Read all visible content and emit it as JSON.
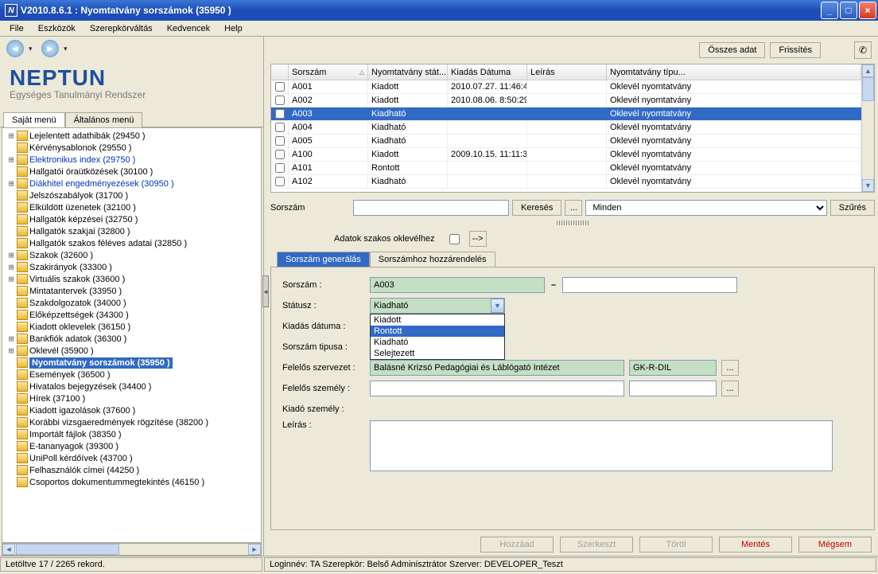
{
  "titlebar": {
    "icon_text": "N",
    "title": "V2010.8.6.1 : Nyomtatvány sorszámok (35950  )"
  },
  "menubar": [
    "File",
    "Eszközök",
    "Szerepkörváltás",
    "Kedvencek",
    "Help"
  ],
  "logo": {
    "name": "NEPTUN",
    "sub": "Egységes Tanulmányi Rendszer"
  },
  "left_tabs": [
    "Saját menü",
    "Általános menü"
  ],
  "tree": [
    {
      "exp": "+",
      "label": "Lejelentett adathibák (29450  )"
    },
    {
      "exp": "",
      "label": "Kérvénysablonok (29550  )"
    },
    {
      "exp": "+",
      "label": "Elektronikus index (29750  )",
      "link": true
    },
    {
      "exp": "",
      "label": "Hallgatói óraütközések (30100  )"
    },
    {
      "exp": "+",
      "label": "Diákhitel engedményezések (30950  )",
      "link": true
    },
    {
      "exp": "",
      "label": "Jelszószabályok (31700  )"
    },
    {
      "exp": "",
      "label": "Elküldött üzenetek (32100  )"
    },
    {
      "exp": "",
      "label": "Hallgatók képzései (32750  )"
    },
    {
      "exp": "",
      "label": "Hallgatók szakjai (32800  )"
    },
    {
      "exp": "",
      "label": "Hallgatók szakos féléves adatai (32850  )"
    },
    {
      "exp": "+",
      "label": "Szakok (32600  )"
    },
    {
      "exp": "+",
      "label": "Szakirányok (33300  )"
    },
    {
      "exp": "+",
      "label": "Virtuális szakok (33600  )"
    },
    {
      "exp": "",
      "label": "Mintatantervek (33950  )"
    },
    {
      "exp": "",
      "label": "Szakdolgozatok (34000  )"
    },
    {
      "exp": "",
      "label": "Előképzettségek (34300  )"
    },
    {
      "exp": "",
      "label": "Kiadott oklevelek (36150  )"
    },
    {
      "exp": "+",
      "label": "Bankfiók adatok (36300  )"
    },
    {
      "exp": "+",
      "label": "Oklevél (35900  )"
    },
    {
      "exp": "",
      "label": "Nyomtatvány sorszámok (35950  )",
      "selected": true
    },
    {
      "exp": "",
      "label": "Események (36500  )"
    },
    {
      "exp": "",
      "label": "Hivatalos bejegyzések (34400  )"
    },
    {
      "exp": "",
      "label": "Hírek (37100  )"
    },
    {
      "exp": "",
      "label": "Kiadott igazolások (37600  )"
    },
    {
      "exp": "",
      "label": "Korábbi vizsgaeredmények rögzítése (38200  )"
    },
    {
      "exp": "",
      "label": "Importált fájlok (38350  )"
    },
    {
      "exp": "",
      "label": "E-tananyagok (39300  )"
    },
    {
      "exp": "",
      "label": "UniPoll kérdőívek (43700  )"
    },
    {
      "exp": "",
      "label": "Felhasználók címei (44250  )"
    },
    {
      "exp": "",
      "label": "Csoportos dokumentummegtekintés (46150  )"
    }
  ],
  "toolbar": {
    "osszes": "Összes adat",
    "frissites": "Frissítés"
  },
  "grid": {
    "headers": {
      "sorszam": "Sorszám",
      "stat": "Nyomtatvány stát...",
      "date": "Kiadás Dátuma",
      "leiras": "Leírás",
      "tip": "Nyomtatvány típu..."
    },
    "rows": [
      {
        "sorszam": "A001",
        "stat": "Kiadott",
        "date": "2010.07.27. 11:46:4",
        "leiras": "",
        "tip": "Oklevél nyomtatvány"
      },
      {
        "sorszam": "A002",
        "stat": "Kiadott",
        "date": "2010.08.06. 8:50:29",
        "leiras": "",
        "tip": "Oklevél nyomtatvány"
      },
      {
        "sorszam": "A003",
        "stat": "Kiadható",
        "date": "",
        "leiras": "",
        "tip": "Oklevél nyomtatvány",
        "selected": true
      },
      {
        "sorszam": "A004",
        "stat": "Kiadható",
        "date": "",
        "leiras": "",
        "tip": "Oklevél nyomtatvány"
      },
      {
        "sorszam": "A005",
        "stat": "Kiadható",
        "date": "",
        "leiras": "",
        "tip": "Oklevél nyomtatvány"
      },
      {
        "sorszam": "A100",
        "stat": "Kiadott",
        "date": "2009.10.15. 11:11:3",
        "leiras": "",
        "tip": "Oklevél nyomtatvány"
      },
      {
        "sorszam": "A101",
        "stat": "Rontott",
        "date": "",
        "leiras": "",
        "tip": "Oklevél nyomtatvány"
      },
      {
        "sorszam": "A102",
        "stat": "Kiadható",
        "date": "",
        "leiras": "",
        "tip": "Oklevél nyomtatvány"
      }
    ]
  },
  "search": {
    "label": "Sorszám",
    "kereses": "Keresés",
    "ellipsis": "...",
    "filter": "Minden",
    "szures": "Szűrés"
  },
  "adatok": {
    "label": "Adatok szakos oklevélhez",
    "arrow": "-->"
  },
  "low_tabs": [
    "Sorszám generálás",
    "Sorszámhoz hozzárendelés"
  ],
  "form": {
    "sorszam_label": "Sorszám :",
    "sorszam_value": "A003",
    "sorszam_to": "",
    "statusz_label": "Státusz :",
    "statusz_value": "Kiadható",
    "statusz_options": [
      "Kiadott",
      "Rontott",
      "Kiadható",
      "Selejtezett"
    ],
    "statusz_selected_idx": 1,
    "kiadas_label": "Kiadás dátuma :",
    "tipus_label": "Sorszám tipusa :",
    "szervezet_label": "Felelős szervezet :",
    "szervezet_value": "Balásné Krizsó Pedagógiai és Láblógató Intézet",
    "szervezet_code": "GK-R-DIL",
    "szemely_label": "Felelős személy :",
    "kiado_label": "Kiadó személy :",
    "leiras_label": "Leírás :",
    "ellipsis": "..."
  },
  "buttons": {
    "hozzaad": "Hozzáad",
    "szerkeszt": "Szerkeszt",
    "torol": "Töröl",
    "mentes": "Mentés",
    "megsem": "Mégsem"
  },
  "status": {
    "left": "Letöltve 17 / 2265 rekord.",
    "right": "Loginnév: TA   Szerepkör: Belső Adminisztrátor   Szerver: DEVELOPER_Teszt"
  }
}
